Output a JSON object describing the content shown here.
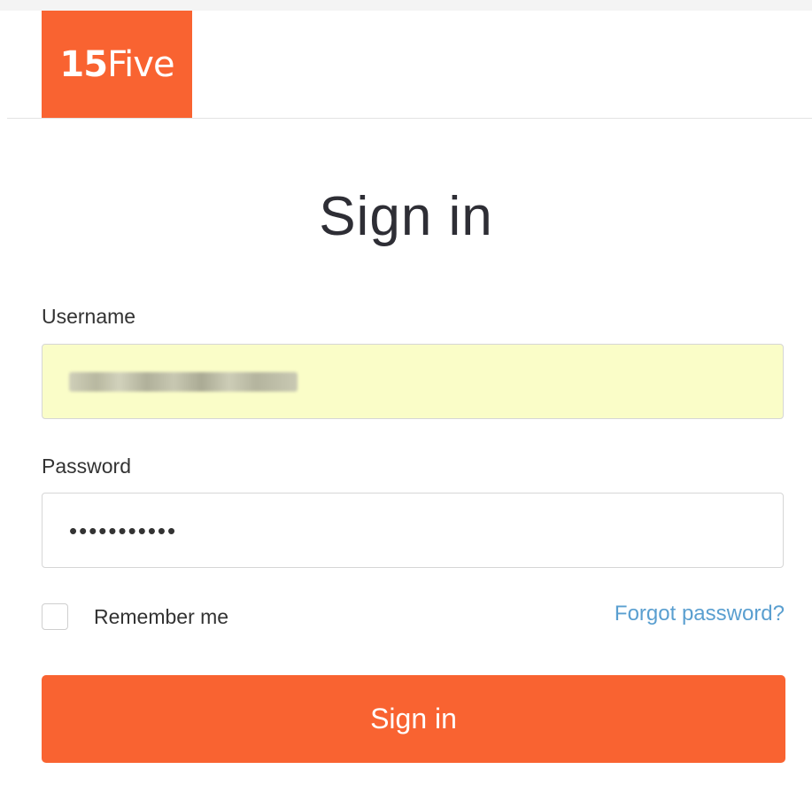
{
  "brand": {
    "logo_number": "15",
    "logo_word": "Five",
    "color": "#f96331"
  },
  "page": {
    "title": "Sign in"
  },
  "form": {
    "username_label": "Username",
    "username_value": "(obscured email)",
    "password_label": "Password",
    "password_value": "•••••••••••",
    "remember_label": "Remember me",
    "remember_checked": false,
    "forgot_link": "Forgot password?",
    "submit_label": "Sign in"
  },
  "colors": {
    "accent": "#f96331",
    "link": "#5a9fd0",
    "autofill_bg": "#fafdc8"
  }
}
